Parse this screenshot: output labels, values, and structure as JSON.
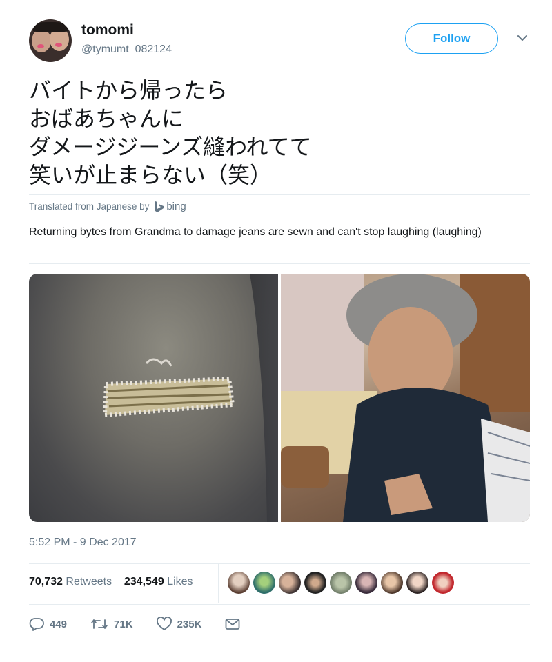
{
  "user": {
    "display_name": "tomomi",
    "handle": "@tymumt_082124",
    "follow_label": "Follow"
  },
  "tweet": {
    "text_lines": [
      "バイトから帰ったら",
      "おばあちゃんに",
      "ダメージジーンズ縫われてて",
      "笑いが止まらない（笑）"
    ],
    "translated_from": "Translated from Japanese by",
    "translator": "bing",
    "translation": "Returning bytes from Grandma to damage jeans are sewn and can't stop laughing (laughing)",
    "timestamp": "5:52 PM - 9 Dec 2017"
  },
  "stats": {
    "retweets_count": "70,732",
    "retweets_label": "Retweets",
    "likes_count": "234,549",
    "likes_label": "Likes"
  },
  "actions": {
    "reply_count": "449",
    "retweet_count": "71K",
    "like_count": "235K"
  },
  "icons": [
    "chevron-down-icon",
    "bing-icon",
    "reply-icon",
    "retweet-icon",
    "heart-icon",
    "mail-icon"
  ],
  "colors": {
    "accent": "#1da1f2",
    "muted": "#657786",
    "text": "#14171a",
    "divider": "#e6ecf0"
  }
}
